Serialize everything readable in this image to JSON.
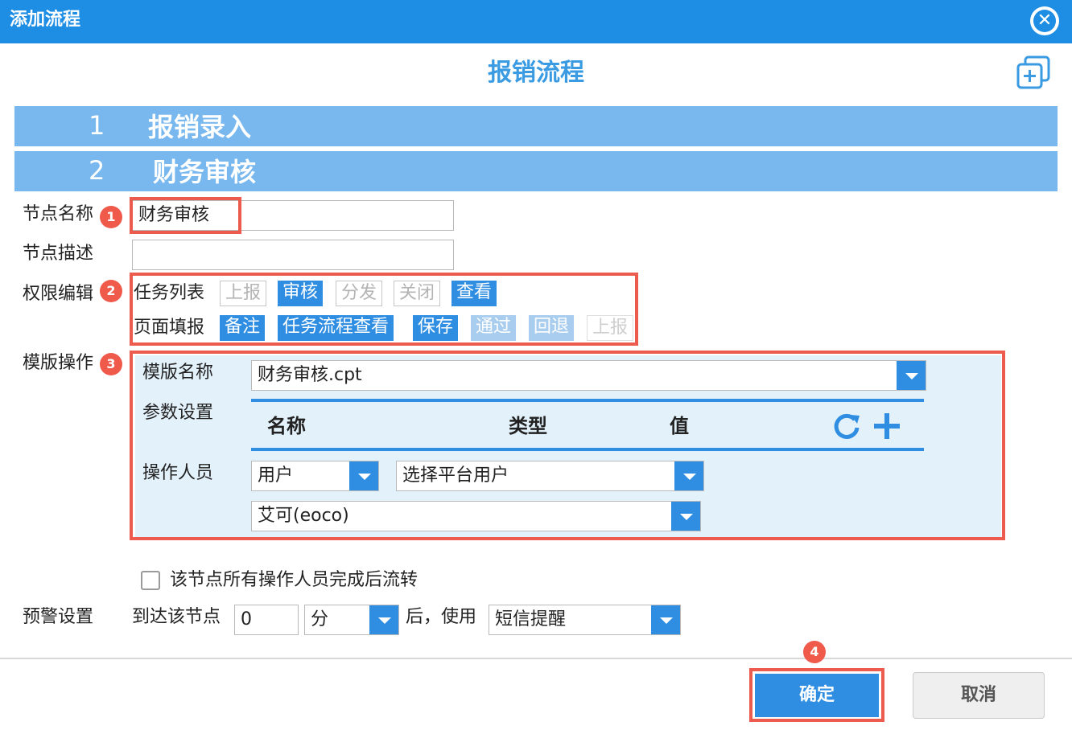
{
  "window": {
    "title": "添加流程"
  },
  "flow_title": "报销流程",
  "steps": [
    {
      "num": "1",
      "name": "报销录入"
    },
    {
      "num": "2",
      "name": "财务审核"
    }
  ],
  "node": {
    "name_label": "节点名称",
    "name_value": "财务审核",
    "desc_label": "节点描述",
    "desc_value": ""
  },
  "permissions": {
    "label": "权限编辑",
    "task_list": {
      "label": "任务列表",
      "items": [
        {
          "label": "上报",
          "state": "off"
        },
        {
          "label": "审核",
          "state": "on"
        },
        {
          "label": "分发",
          "state": "off"
        },
        {
          "label": "关闭",
          "state": "off"
        },
        {
          "label": "查看",
          "state": "on"
        }
      ]
    },
    "page_fill": {
      "label": "页面填报",
      "items": [
        {
          "label": "备注",
          "state": "on"
        },
        {
          "label": "任务流程查看",
          "state": "on"
        },
        {
          "label": "保存",
          "state": "on"
        },
        {
          "label": "通过",
          "state": "pale"
        },
        {
          "label": "回退",
          "state": "pale"
        },
        {
          "label": "上报",
          "state": "off"
        }
      ]
    }
  },
  "template": {
    "label": "模版操作",
    "name_label": "模版名称",
    "name_value": "财务审核.cpt",
    "params_label": "参数设置",
    "columns": {
      "name": "名称",
      "type": "类型",
      "value": "值"
    },
    "operator_label": "操作人员",
    "operator_type": "用户",
    "operator_select": "选择平台用户",
    "operator_user": "艾可(eoco)"
  },
  "flow_after_all": {
    "label": "该节点所有操作人员完成后流转",
    "checked": false
  },
  "warning": {
    "label": "预警设置",
    "arrive_text": "到达该节点",
    "amount": "0",
    "unit": "分",
    "after_text": "后，使用",
    "method": "短信提醒"
  },
  "badges": [
    "1",
    "2",
    "3",
    "4"
  ],
  "buttons": {
    "ok": "确定",
    "cancel": "取消"
  },
  "colors": {
    "titlebar": "#1e8ee5",
    "step_bar": "#78b8ef",
    "accent": "#2f8ee2",
    "highlight": "#ec5b4e",
    "panel": "#e3f1fb"
  }
}
